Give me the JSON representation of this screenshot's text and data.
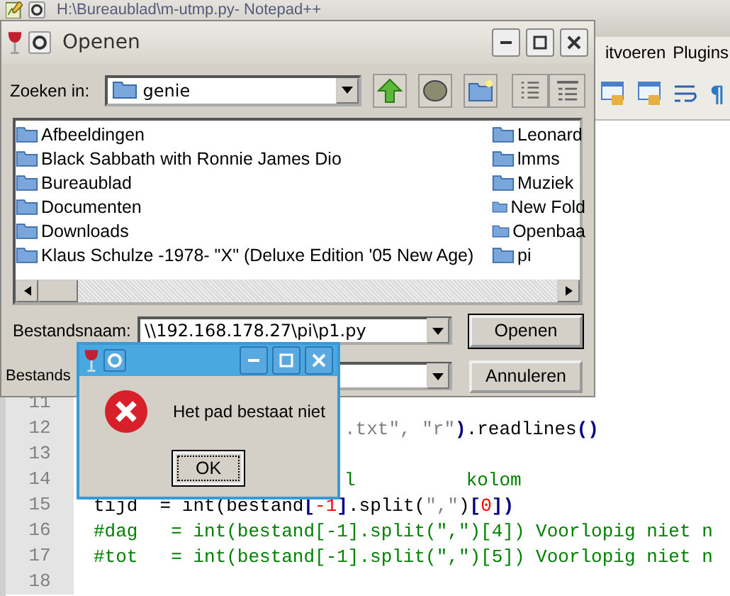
{
  "editor_window": {
    "title": "H:\\Bureaublad\\m-utmp.py- Notepad++",
    "menu": [
      "itvoeren",
      "Plugins"
    ],
    "toolbar_glyph": "¶"
  },
  "editor": {
    "lines": [
      {
        "number": "11"
      },
      {
        "number": "12",
        "covered": true,
        "tokens": [
          {
            "kind": "string",
            "text": ".txt\", \"r\""
          },
          {
            "kind": "op",
            "text": ")"
          },
          {
            "kind": "plain",
            "text": ".readlines"
          },
          {
            "kind": "op",
            "text": "()"
          }
        ]
      },
      {
        "number": "13"
      },
      {
        "number": "14",
        "covered": true,
        "tokens": [
          {
            "kind": "comment",
            "text": "l          kolom"
          }
        ]
      },
      {
        "number": "15",
        "tokens": [
          {
            "kind": "plain",
            "text": "tijd  = int(bestand"
          },
          {
            "kind": "op",
            "text": "["
          },
          {
            "kind": "num",
            "text": "-1"
          },
          {
            "kind": "op",
            "text": "]"
          },
          {
            "kind": "plain",
            "text": ".split("
          },
          {
            "kind": "string",
            "text": "\",\""
          },
          {
            "kind": "plain",
            "text": ")"
          },
          {
            "kind": "op",
            "text": "["
          },
          {
            "kind": "num",
            "text": "0"
          },
          {
            "kind": "op",
            "text": "])"
          }
        ]
      },
      {
        "number": "16",
        "tokens": [
          {
            "kind": "comment",
            "text": "#dag   = int(bestand[-1].split(\",\")[4]) Voorlopig niet n"
          }
        ]
      },
      {
        "number": "17",
        "tokens": [
          {
            "kind": "comment",
            "text": "#tot   = int(bestand[-1].split(\",\")[5]) Voorlopig niet n"
          }
        ]
      },
      {
        "number": "18"
      }
    ]
  },
  "open_dialog": {
    "title": "Openen",
    "look_in_label": "Zoeken in:",
    "look_in_value": "genie",
    "files": [
      "Afbeeldingen",
      "Black Sabbath with Ronnie James Dio",
      "Bureaublad",
      "Documenten",
      "Downloads",
      "Klaus Schulze -1978- \"X\" (Deluxe Edition '05 New Age)",
      "Leonard",
      "lmms",
      "Muziek",
      "New Fold",
      "Openbaa",
      "pi"
    ],
    "file_name_label": "Bestandsnaam:",
    "file_name_value": "\\\\192.168.178.27\\pi\\p1.py",
    "file_type_label": "Bestands",
    "buttons": [
      "Openen",
      "Annuleren"
    ]
  },
  "message_box": {
    "message": "Het pad bestaat niet",
    "button": "OK"
  }
}
